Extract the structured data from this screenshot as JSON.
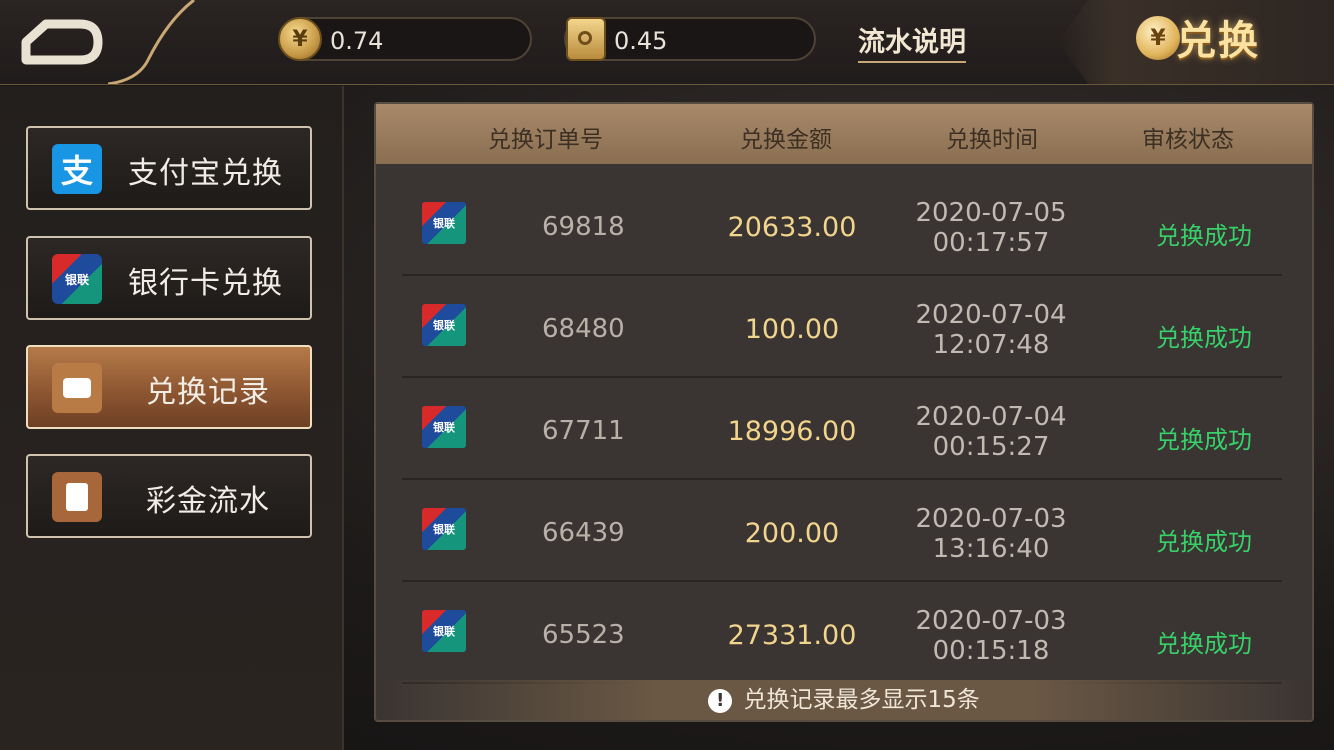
{
  "topbar": {
    "balance_1": "0.74",
    "balance_2": "0.45",
    "flow_link": "流水说明",
    "exchange_label": "兑换",
    "coin_symbol": "¥"
  },
  "sidebar": {
    "items": [
      {
        "label": "支付宝兑换",
        "icon": "alipay-icon",
        "icon_glyph": "支"
      },
      {
        "label": "银行卡兑换",
        "icon": "unionpay-icon",
        "icon_glyph": "银联"
      },
      {
        "label": "兑换记录",
        "icon": "wallet-icon",
        "active": true
      },
      {
        "label": "彩金流水",
        "icon": "bonus-flow-icon"
      }
    ]
  },
  "table": {
    "headers": [
      "兑换订单号",
      "兑换金额",
      "兑换时间",
      "审核状态"
    ],
    "bank_icon_glyph": "银联",
    "rows": [
      {
        "order": "69818",
        "amount": "20633.00",
        "date": "2020-07-05",
        "time": "00:17:57",
        "status": "兑换成功"
      },
      {
        "order": "68480",
        "amount": "100.00",
        "date": "2020-07-04",
        "time": "12:07:48",
        "status": "兑换成功"
      },
      {
        "order": "67711",
        "amount": "18996.00",
        "date": "2020-07-04",
        "time": "00:15:27",
        "status": "兑换成功"
      },
      {
        "order": "66439",
        "amount": "200.00",
        "date": "2020-07-03",
        "time": "13:16:40",
        "status": "兑换成功"
      },
      {
        "order": "65523",
        "amount": "27331.00",
        "date": "2020-07-03",
        "time": "00:15:18",
        "status": "兑换成功"
      }
    ],
    "footer_note": "兑换记录最多显示15条",
    "footer_icon": "!"
  },
  "colors": {
    "status_success": "#37d16a",
    "amount": "#f2d58d",
    "accent_gold": "#c9a875"
  }
}
